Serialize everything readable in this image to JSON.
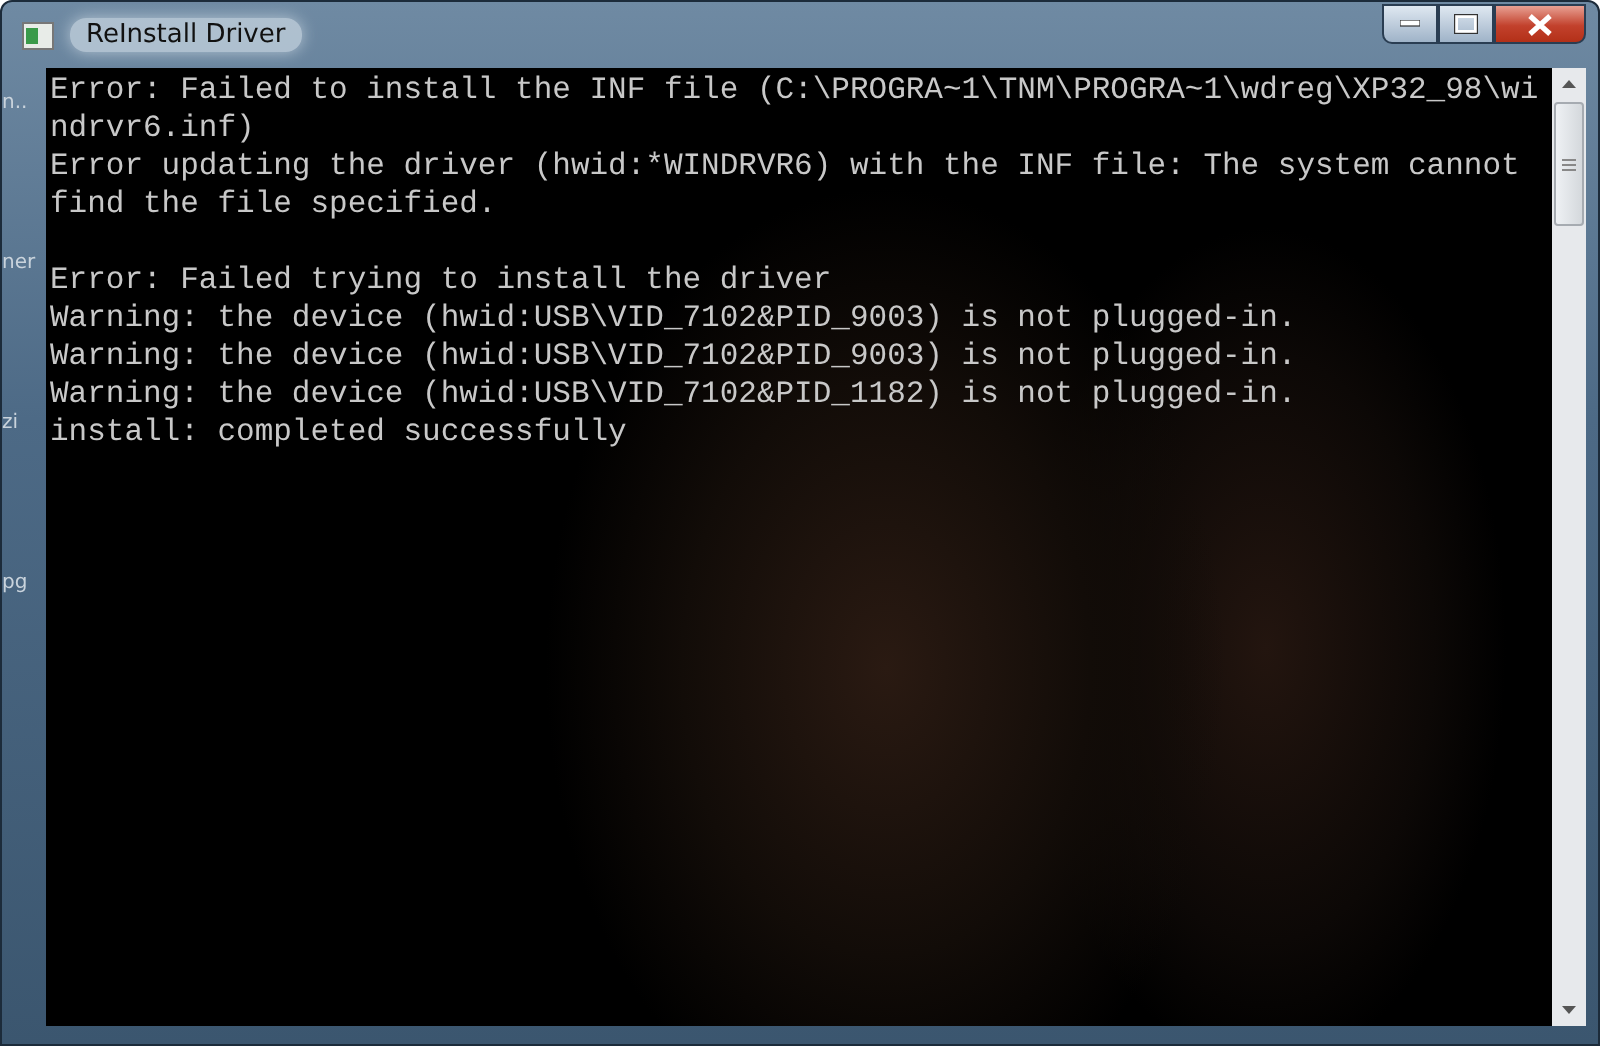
{
  "window": {
    "title": "ReInstall Driver"
  },
  "desktop_icon_labels": [
    "n..",
    "ner",
    "zi",
    "pg"
  ],
  "console": {
    "blocks": [
      [
        "Error: Failed to install the INF file (C:\\PROGRA~1\\TNM\\PROGRA~1\\wdreg\\XP32_98\\wi",
        "ndrvr6.inf)",
        "Error updating the driver (hwid:*WINDRVR6) with the INF file: The system cannot ",
        "find the file specified."
      ],
      [
        "Error: Failed trying to install the driver",
        "Warning: the device (hwid:USB\\VID_7102&PID_9003) is not plugged-in.",
        "Warning: the device (hwid:USB\\VID_7102&PID_9003) is not plugged-in.",
        "Warning: the device (hwid:USB\\VID_7102&PID_1182) is not plugged-in.",
        "install: completed successfully"
      ]
    ]
  }
}
